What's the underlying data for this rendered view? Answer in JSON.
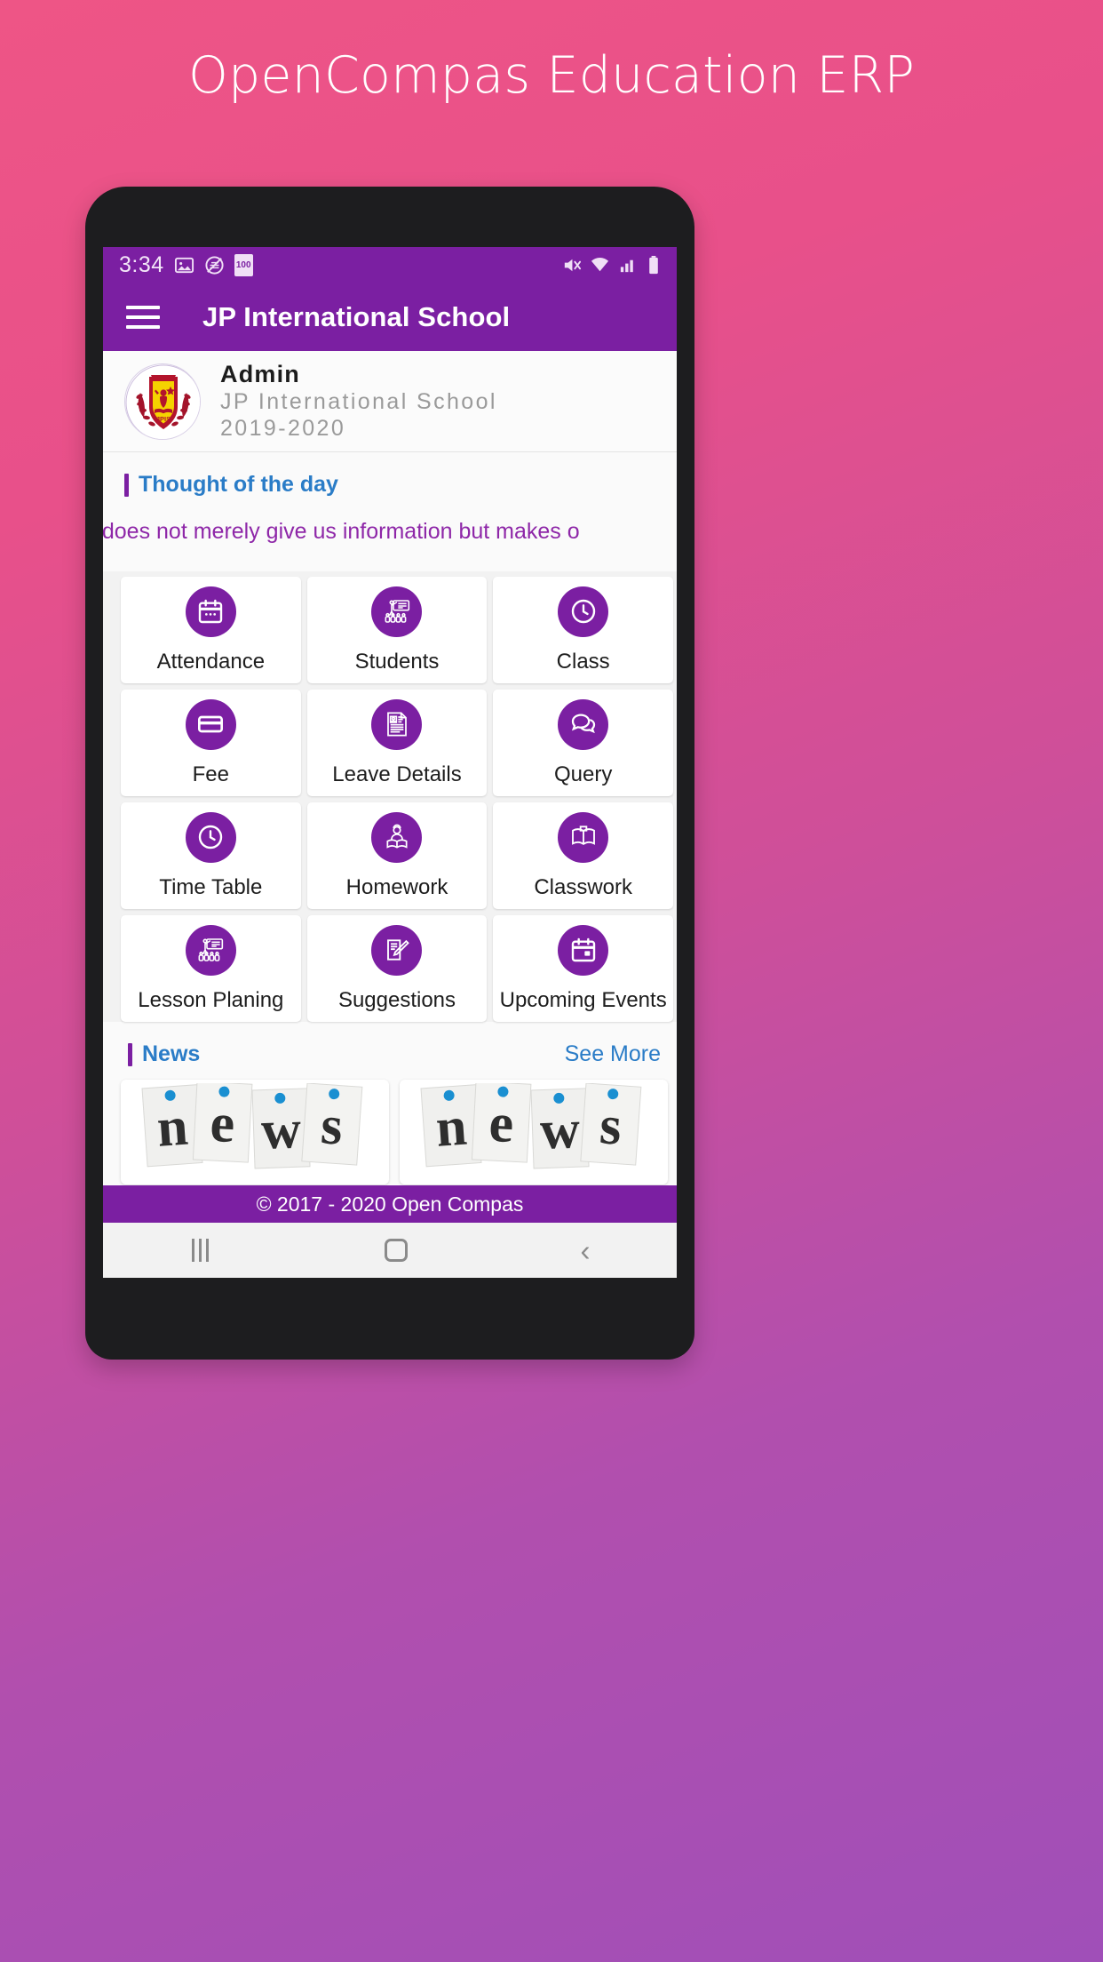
{
  "promo": {
    "title": "OpenCompas Education ERP"
  },
  "statusbar": {
    "time": "3:34",
    "battery_text": "100",
    "left_icons": [
      "image-icon",
      "screenshot-icon",
      "battery-clipboard-icon"
    ],
    "right_icons": [
      "mute-icon",
      "wifi-icon",
      "signal-icon",
      "battery-icon"
    ]
  },
  "appbar": {
    "menu_icon": "hamburger-icon",
    "title": "JP International School"
  },
  "profile": {
    "logo_alt": "JPIS school crest",
    "logo_text": "JPIS",
    "name": "Admin",
    "school": "JP International School",
    "session": "2019-2020"
  },
  "thought": {
    "heading": "Thought of the day",
    "quote": "which does not merely give us information but makes o"
  },
  "menu": {
    "items": [
      {
        "label": "Attendance",
        "icon": "calendar-icon"
      },
      {
        "label": "Students",
        "icon": "classroom-icon"
      },
      {
        "label": "Class",
        "icon": "clock-icon"
      },
      {
        "label": "Fee",
        "icon": "credit-card-icon"
      },
      {
        "label": "Leave Details",
        "icon": "document-profile-icon"
      },
      {
        "label": "Query",
        "icon": "chat-bubbles-icon"
      },
      {
        "label": "Time Table",
        "icon": "clock-icon"
      },
      {
        "label": "Homework",
        "icon": "student-reading-icon"
      },
      {
        "label": "Classwork",
        "icon": "open-book-icon"
      },
      {
        "label": "Lesson Planing",
        "icon": "classroom-icon"
      },
      {
        "label": "Suggestions",
        "icon": "edit-document-icon"
      },
      {
        "label": "Upcoming Events",
        "icon": "calendar-event-icon"
      }
    ]
  },
  "news": {
    "heading": "News",
    "see_more": "See More",
    "cards": [
      {
        "image_alt": "news pinned paper notes"
      },
      {
        "image_alt": "news pinned paper notes"
      }
    ]
  },
  "footer": {
    "copyright": "© 2017 - 2020 Open Compas"
  },
  "navbar": {
    "recents": "recents-icon",
    "home": "home-icon",
    "back": "back-icon"
  },
  "colors": {
    "primary_purple": "#7B1FA2",
    "accent_blue": "#2a7cc7",
    "quote_purple": "#8e27a8",
    "promo_pink": "#ee5586"
  }
}
